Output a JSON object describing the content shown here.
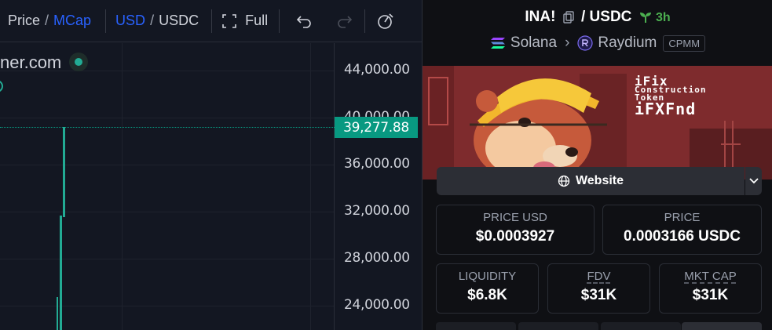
{
  "toolbar": {
    "price_label": "Price",
    "mcap_label": "MCap",
    "usd_label": "USD",
    "usdc_label": "USDC",
    "full_label": "Full",
    "separator": "/"
  },
  "chart": {
    "watermark": "ner.com",
    "y_ticks": [
      "44,000.00",
      "40,000.00",
      "36,000.00",
      "32,000.00",
      "28,000.00",
      "24,000.00"
    ],
    "current_price": "39,277.88",
    "colors": {
      "up": "#22ab94",
      "price_tag": "#089981",
      "background": "#131722"
    }
  },
  "pair": {
    "base": "INA!",
    "separator": "/",
    "quote": "USDC",
    "age": "3h",
    "chain": "Solana",
    "dex": "Raydium",
    "pool_type": "CPMM"
  },
  "banner": {
    "line1": "iFix",
    "line2": "Construction",
    "line3": "Token",
    "line4": "iFXFnd"
  },
  "links": {
    "website_label": "Website"
  },
  "stats": {
    "price_usd_label": "PRICE USD",
    "price_usd_value": "$0.0003927",
    "price_label": "PRICE",
    "price_value": "0.0003166 USDC",
    "liquidity_label": "LIQUIDITY",
    "liquidity_value": "$6.8K",
    "fdv_label": "FDV",
    "fdv_value": "$31K",
    "mktcap_label": "MKT CAP",
    "mktcap_value": "$31K"
  },
  "icons": [
    "fullscreen-icon",
    "undo-icon",
    "redo-icon",
    "snapshot-icon",
    "copy-icon",
    "sprout-icon",
    "solana-icon",
    "raydium-icon",
    "globe-icon",
    "chevron-down-icon"
  ]
}
